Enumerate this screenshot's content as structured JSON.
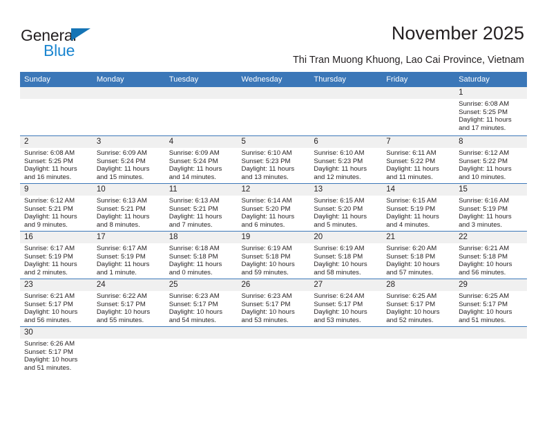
{
  "brand": {
    "name_top": "General",
    "name_bottom": "Blue",
    "accent_color": "#1574b5",
    "accent_color_light": "#1b86d0",
    "triangle_icon": "triangle-icon"
  },
  "header": {
    "title": "November 2025",
    "subtitle": "Thi Tran Muong Khuong, Lao Cai Province, Vietnam"
  },
  "theme": {
    "header_row_bg": "#3b77b8",
    "daynum_band_bg": "#f0f0f0",
    "text_color": "#231f20",
    "grid_line": "#3b77b8"
  },
  "weekdays": [
    "Sunday",
    "Monday",
    "Tuesday",
    "Wednesday",
    "Thursday",
    "Friday",
    "Saturday"
  ],
  "labels": {
    "sunrise_prefix": "Sunrise:",
    "sunset_prefix": "Sunset:",
    "daylight_prefix": "Daylight:"
  },
  "weeks": [
    [
      {
        "day": "",
        "empty": true
      },
      {
        "day": "",
        "empty": true
      },
      {
        "day": "",
        "empty": true
      },
      {
        "day": "",
        "empty": true
      },
      {
        "day": "",
        "empty": true
      },
      {
        "day": "",
        "empty": true
      },
      {
        "day": "1",
        "sunrise": "Sunrise: 6:08 AM",
        "sunset": "Sunset: 5:25 PM",
        "daylight_line1": "Daylight: 11 hours",
        "daylight_line2": "and 17 minutes."
      }
    ],
    [
      {
        "day": "2",
        "sunrise": "Sunrise: 6:08 AM",
        "sunset": "Sunset: 5:25 PM",
        "daylight_line1": "Daylight: 11 hours",
        "daylight_line2": "and 16 minutes."
      },
      {
        "day": "3",
        "sunrise": "Sunrise: 6:09 AM",
        "sunset": "Sunset: 5:24 PM",
        "daylight_line1": "Daylight: 11 hours",
        "daylight_line2": "and 15 minutes."
      },
      {
        "day": "4",
        "sunrise": "Sunrise: 6:09 AM",
        "sunset": "Sunset: 5:24 PM",
        "daylight_line1": "Daylight: 11 hours",
        "daylight_line2": "and 14 minutes."
      },
      {
        "day": "5",
        "sunrise": "Sunrise: 6:10 AM",
        "sunset": "Sunset: 5:23 PM",
        "daylight_line1": "Daylight: 11 hours",
        "daylight_line2": "and 13 minutes."
      },
      {
        "day": "6",
        "sunrise": "Sunrise: 6:10 AM",
        "sunset": "Sunset: 5:23 PM",
        "daylight_line1": "Daylight: 11 hours",
        "daylight_line2": "and 12 minutes."
      },
      {
        "day": "7",
        "sunrise": "Sunrise: 6:11 AM",
        "sunset": "Sunset: 5:22 PM",
        "daylight_line1": "Daylight: 11 hours",
        "daylight_line2": "and 11 minutes."
      },
      {
        "day": "8",
        "sunrise": "Sunrise: 6:12 AM",
        "sunset": "Sunset: 5:22 PM",
        "daylight_line1": "Daylight: 11 hours",
        "daylight_line2": "and 10 minutes."
      }
    ],
    [
      {
        "day": "9",
        "sunrise": "Sunrise: 6:12 AM",
        "sunset": "Sunset: 5:21 PM",
        "daylight_line1": "Daylight: 11 hours",
        "daylight_line2": "and 9 minutes."
      },
      {
        "day": "10",
        "sunrise": "Sunrise: 6:13 AM",
        "sunset": "Sunset: 5:21 PM",
        "daylight_line1": "Daylight: 11 hours",
        "daylight_line2": "and 8 minutes."
      },
      {
        "day": "11",
        "sunrise": "Sunrise: 6:13 AM",
        "sunset": "Sunset: 5:21 PM",
        "daylight_line1": "Daylight: 11 hours",
        "daylight_line2": "and 7 minutes."
      },
      {
        "day": "12",
        "sunrise": "Sunrise: 6:14 AM",
        "sunset": "Sunset: 5:20 PM",
        "daylight_line1": "Daylight: 11 hours",
        "daylight_line2": "and 6 minutes."
      },
      {
        "day": "13",
        "sunrise": "Sunrise: 6:15 AM",
        "sunset": "Sunset: 5:20 PM",
        "daylight_line1": "Daylight: 11 hours",
        "daylight_line2": "and 5 minutes."
      },
      {
        "day": "14",
        "sunrise": "Sunrise: 6:15 AM",
        "sunset": "Sunset: 5:19 PM",
        "daylight_line1": "Daylight: 11 hours",
        "daylight_line2": "and 4 minutes."
      },
      {
        "day": "15",
        "sunrise": "Sunrise: 6:16 AM",
        "sunset": "Sunset: 5:19 PM",
        "daylight_line1": "Daylight: 11 hours",
        "daylight_line2": "and 3 minutes."
      }
    ],
    [
      {
        "day": "16",
        "sunrise": "Sunrise: 6:17 AM",
        "sunset": "Sunset: 5:19 PM",
        "daylight_line1": "Daylight: 11 hours",
        "daylight_line2": "and 2 minutes."
      },
      {
        "day": "17",
        "sunrise": "Sunrise: 6:17 AM",
        "sunset": "Sunset: 5:19 PM",
        "daylight_line1": "Daylight: 11 hours",
        "daylight_line2": "and 1 minute."
      },
      {
        "day": "18",
        "sunrise": "Sunrise: 6:18 AM",
        "sunset": "Sunset: 5:18 PM",
        "daylight_line1": "Daylight: 11 hours",
        "daylight_line2": "and 0 minutes."
      },
      {
        "day": "19",
        "sunrise": "Sunrise: 6:19 AM",
        "sunset": "Sunset: 5:18 PM",
        "daylight_line1": "Daylight: 10 hours",
        "daylight_line2": "and 59 minutes."
      },
      {
        "day": "20",
        "sunrise": "Sunrise: 6:19 AM",
        "sunset": "Sunset: 5:18 PM",
        "daylight_line1": "Daylight: 10 hours",
        "daylight_line2": "and 58 minutes."
      },
      {
        "day": "21",
        "sunrise": "Sunrise: 6:20 AM",
        "sunset": "Sunset: 5:18 PM",
        "daylight_line1": "Daylight: 10 hours",
        "daylight_line2": "and 57 minutes."
      },
      {
        "day": "22",
        "sunrise": "Sunrise: 6:21 AM",
        "sunset": "Sunset: 5:18 PM",
        "daylight_line1": "Daylight: 10 hours",
        "daylight_line2": "and 56 minutes."
      }
    ],
    [
      {
        "day": "23",
        "sunrise": "Sunrise: 6:21 AM",
        "sunset": "Sunset: 5:17 PM",
        "daylight_line1": "Daylight: 10 hours",
        "daylight_line2": "and 56 minutes."
      },
      {
        "day": "24",
        "sunrise": "Sunrise: 6:22 AM",
        "sunset": "Sunset: 5:17 PM",
        "daylight_line1": "Daylight: 10 hours",
        "daylight_line2": "and 55 minutes."
      },
      {
        "day": "25",
        "sunrise": "Sunrise: 6:23 AM",
        "sunset": "Sunset: 5:17 PM",
        "daylight_line1": "Daylight: 10 hours",
        "daylight_line2": "and 54 minutes."
      },
      {
        "day": "26",
        "sunrise": "Sunrise: 6:23 AM",
        "sunset": "Sunset: 5:17 PM",
        "daylight_line1": "Daylight: 10 hours",
        "daylight_line2": "and 53 minutes."
      },
      {
        "day": "27",
        "sunrise": "Sunrise: 6:24 AM",
        "sunset": "Sunset: 5:17 PM",
        "daylight_line1": "Daylight: 10 hours",
        "daylight_line2": "and 53 minutes."
      },
      {
        "day": "28",
        "sunrise": "Sunrise: 6:25 AM",
        "sunset": "Sunset: 5:17 PM",
        "daylight_line1": "Daylight: 10 hours",
        "daylight_line2": "and 52 minutes."
      },
      {
        "day": "29",
        "sunrise": "Sunrise: 6:25 AM",
        "sunset": "Sunset: 5:17 PM",
        "daylight_line1": "Daylight: 10 hours",
        "daylight_line2": "and 51 minutes."
      }
    ],
    [
      {
        "day": "30",
        "sunrise": "Sunrise: 6:26 AM",
        "sunset": "Sunset: 5:17 PM",
        "daylight_line1": "Daylight: 10 hours",
        "daylight_line2": "and 51 minutes."
      },
      {
        "day": "",
        "empty": true
      },
      {
        "day": "",
        "empty": true
      },
      {
        "day": "",
        "empty": true
      },
      {
        "day": "",
        "empty": true
      },
      {
        "day": "",
        "empty": true
      },
      {
        "day": "",
        "empty": true
      }
    ]
  ]
}
